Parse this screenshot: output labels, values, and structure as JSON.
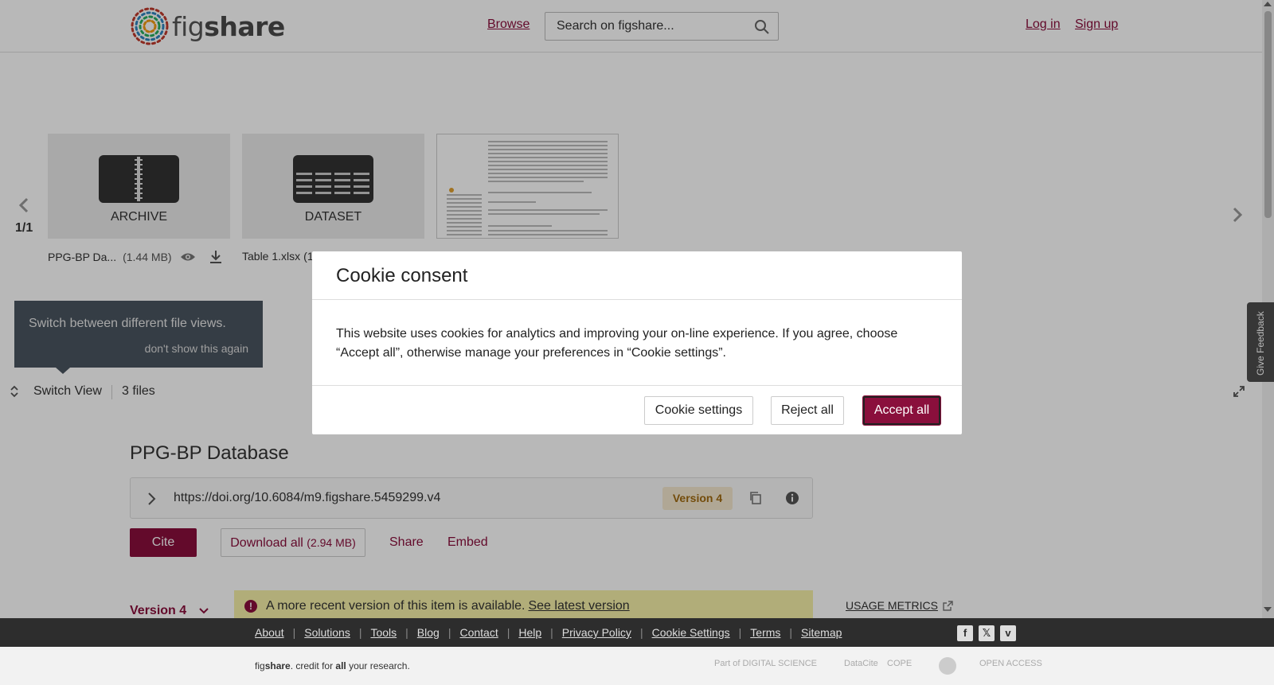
{
  "header": {
    "logo_text_prefix": "fig",
    "logo_text_suffix": "share",
    "browse_label": "Browse",
    "search_placeholder": "Search on figshare...",
    "login_label": "Log in",
    "signup_label": "Sign up"
  },
  "carousel": {
    "pager": "1/1",
    "files": [
      {
        "type": "ARCHIVE",
        "name": "PPG-BP Da...",
        "size": "(1.44 MB)"
      },
      {
        "type": "DATASET",
        "name": "Table 1.xlsx",
        "size": "(1"
      },
      {
        "type": "",
        "name": "",
        "size": ""
      }
    ]
  },
  "tooltip": {
    "text": "Switch between different file views.",
    "dismiss": "don't show this again"
  },
  "switch_bar": {
    "label": "Switch View",
    "files_count": "3 files"
  },
  "feedback_label": "Give Feedback",
  "item": {
    "title": "PPG-BP Database",
    "doi": "https://doi.org/10.6084/m9.figshare.5459299.v4",
    "version_badge": "Version 4",
    "cite_label": "Cite",
    "download_label": "Download all",
    "download_size": "(2.94 MB)",
    "share_label": "Share",
    "embed_label": "Embed",
    "version_select": "Version 4",
    "notice_text": "A more recent version of this item is available.",
    "notice_link": "See latest version",
    "usage_metrics": "USAGE METRICS"
  },
  "modal": {
    "title": "Cookie consent",
    "body": "This website uses cookies for analytics and improving your on-line experience. If you agree, choose “Accept all”, otherwise manage your preferences in “Cookie settings”.",
    "settings_label": "Cookie settings",
    "reject_label": "Reject all",
    "accept_label": "Accept all"
  },
  "footer": {
    "links": [
      "About",
      "Solutions",
      "Tools",
      "Blog",
      "Contact",
      "Help",
      "Privacy Policy",
      "Cookie Settings",
      "Terms",
      "Sitemap"
    ],
    "tagline_brand_prefix": "fig",
    "tagline_brand_suffix": "share",
    "tagline_text_1": ". credit for ",
    "tagline_bold": "all",
    "tagline_text_2": " your research.",
    "partners": [
      "Part of DIGITAL SCIENCE",
      "DataCite",
      "COPE",
      "",
      "OPEN ACCESS"
    ]
  },
  "colors": {
    "brand": "#8a0f3c",
    "notice_bg": "#f5f0a8",
    "badge_bg": "#f4e8cf",
    "footer_dark": "#2d2d2d"
  }
}
